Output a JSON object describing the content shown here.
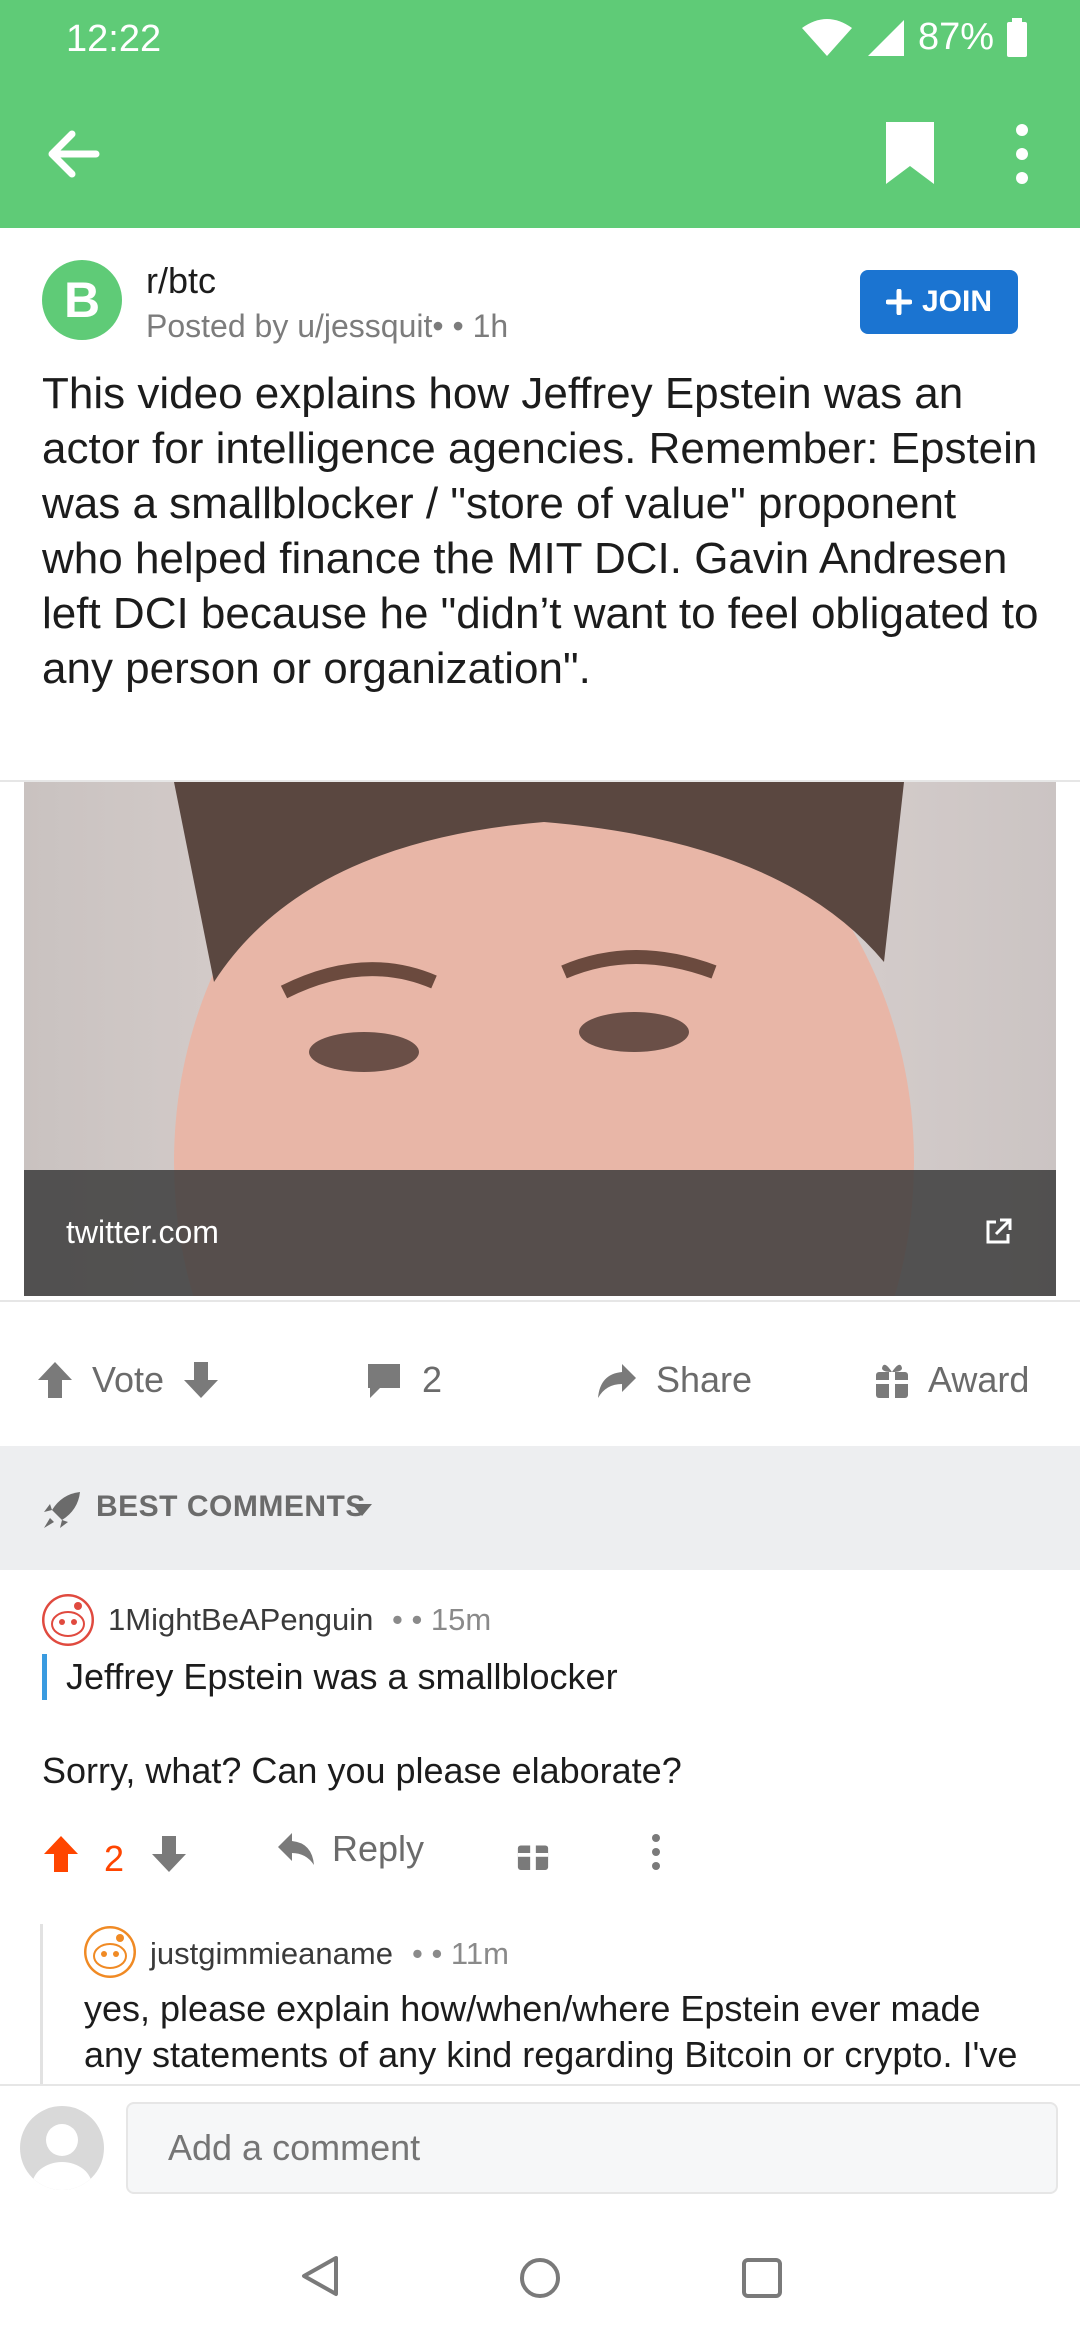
{
  "status_bar": {
    "time": "12:22",
    "battery": "87%"
  },
  "post": {
    "subreddit": "r/btc",
    "subreddit_icon_letter": "B",
    "posted_by": "Posted by u/jessquit• • 1h",
    "join_label": "JOIN",
    "title": "This video explains how Jeffrey Epstein was an actor for intelligence agencies. Remember: Epstein was a smallblocker / \"store of value\" proponent who helped finance the MIT DCI. Gavin Andresen left DCI because he \"didn’t want to feel obligated to any person or organization\".",
    "link_domain": "twitter.com"
  },
  "actions": {
    "vote_label": "Vote",
    "comments_count": "2",
    "share_label": "Share",
    "award_label": "Award"
  },
  "comments_header": {
    "sort_label": "BEST COMMENTS"
  },
  "comments": [
    {
      "author": "1MightBeAPenguin",
      "meta": "• • 15m",
      "quote": "Jeffrey Epstein was a smallblocker",
      "body": "Sorry, what? Can you please elaborate?",
      "score": "2",
      "reply_label": "Reply"
    },
    {
      "author": "justgimmieaname",
      "meta": "• • 11m",
      "body": "yes, please explain how/when/where Epstein ever made any statements of any kind regarding Bitcoin or crypto.  I've followed the Epstein story closely and this is new to"
    }
  ],
  "compose": {
    "placeholder": "Add a comment"
  },
  "colors": {
    "header_green": "#5fcb77",
    "join_blue": "#1b74d1",
    "upvote_orange": "#ff4500",
    "quote_blue": "#3a9be0"
  },
  "icons": [
    "back-arrow-icon",
    "bookmark-icon",
    "more-vertical-icon",
    "wifi-icon",
    "signal-icon",
    "battery-icon",
    "plus-icon",
    "external-link-icon",
    "upvote-icon",
    "downvote-icon",
    "comment-icon",
    "share-icon",
    "award-icon",
    "rocket-icon",
    "chevron-down-icon",
    "reply-icon",
    "gift-icon",
    "user-avatar-icon",
    "nav-back-icon",
    "nav-home-icon",
    "nav-recents-icon"
  ]
}
